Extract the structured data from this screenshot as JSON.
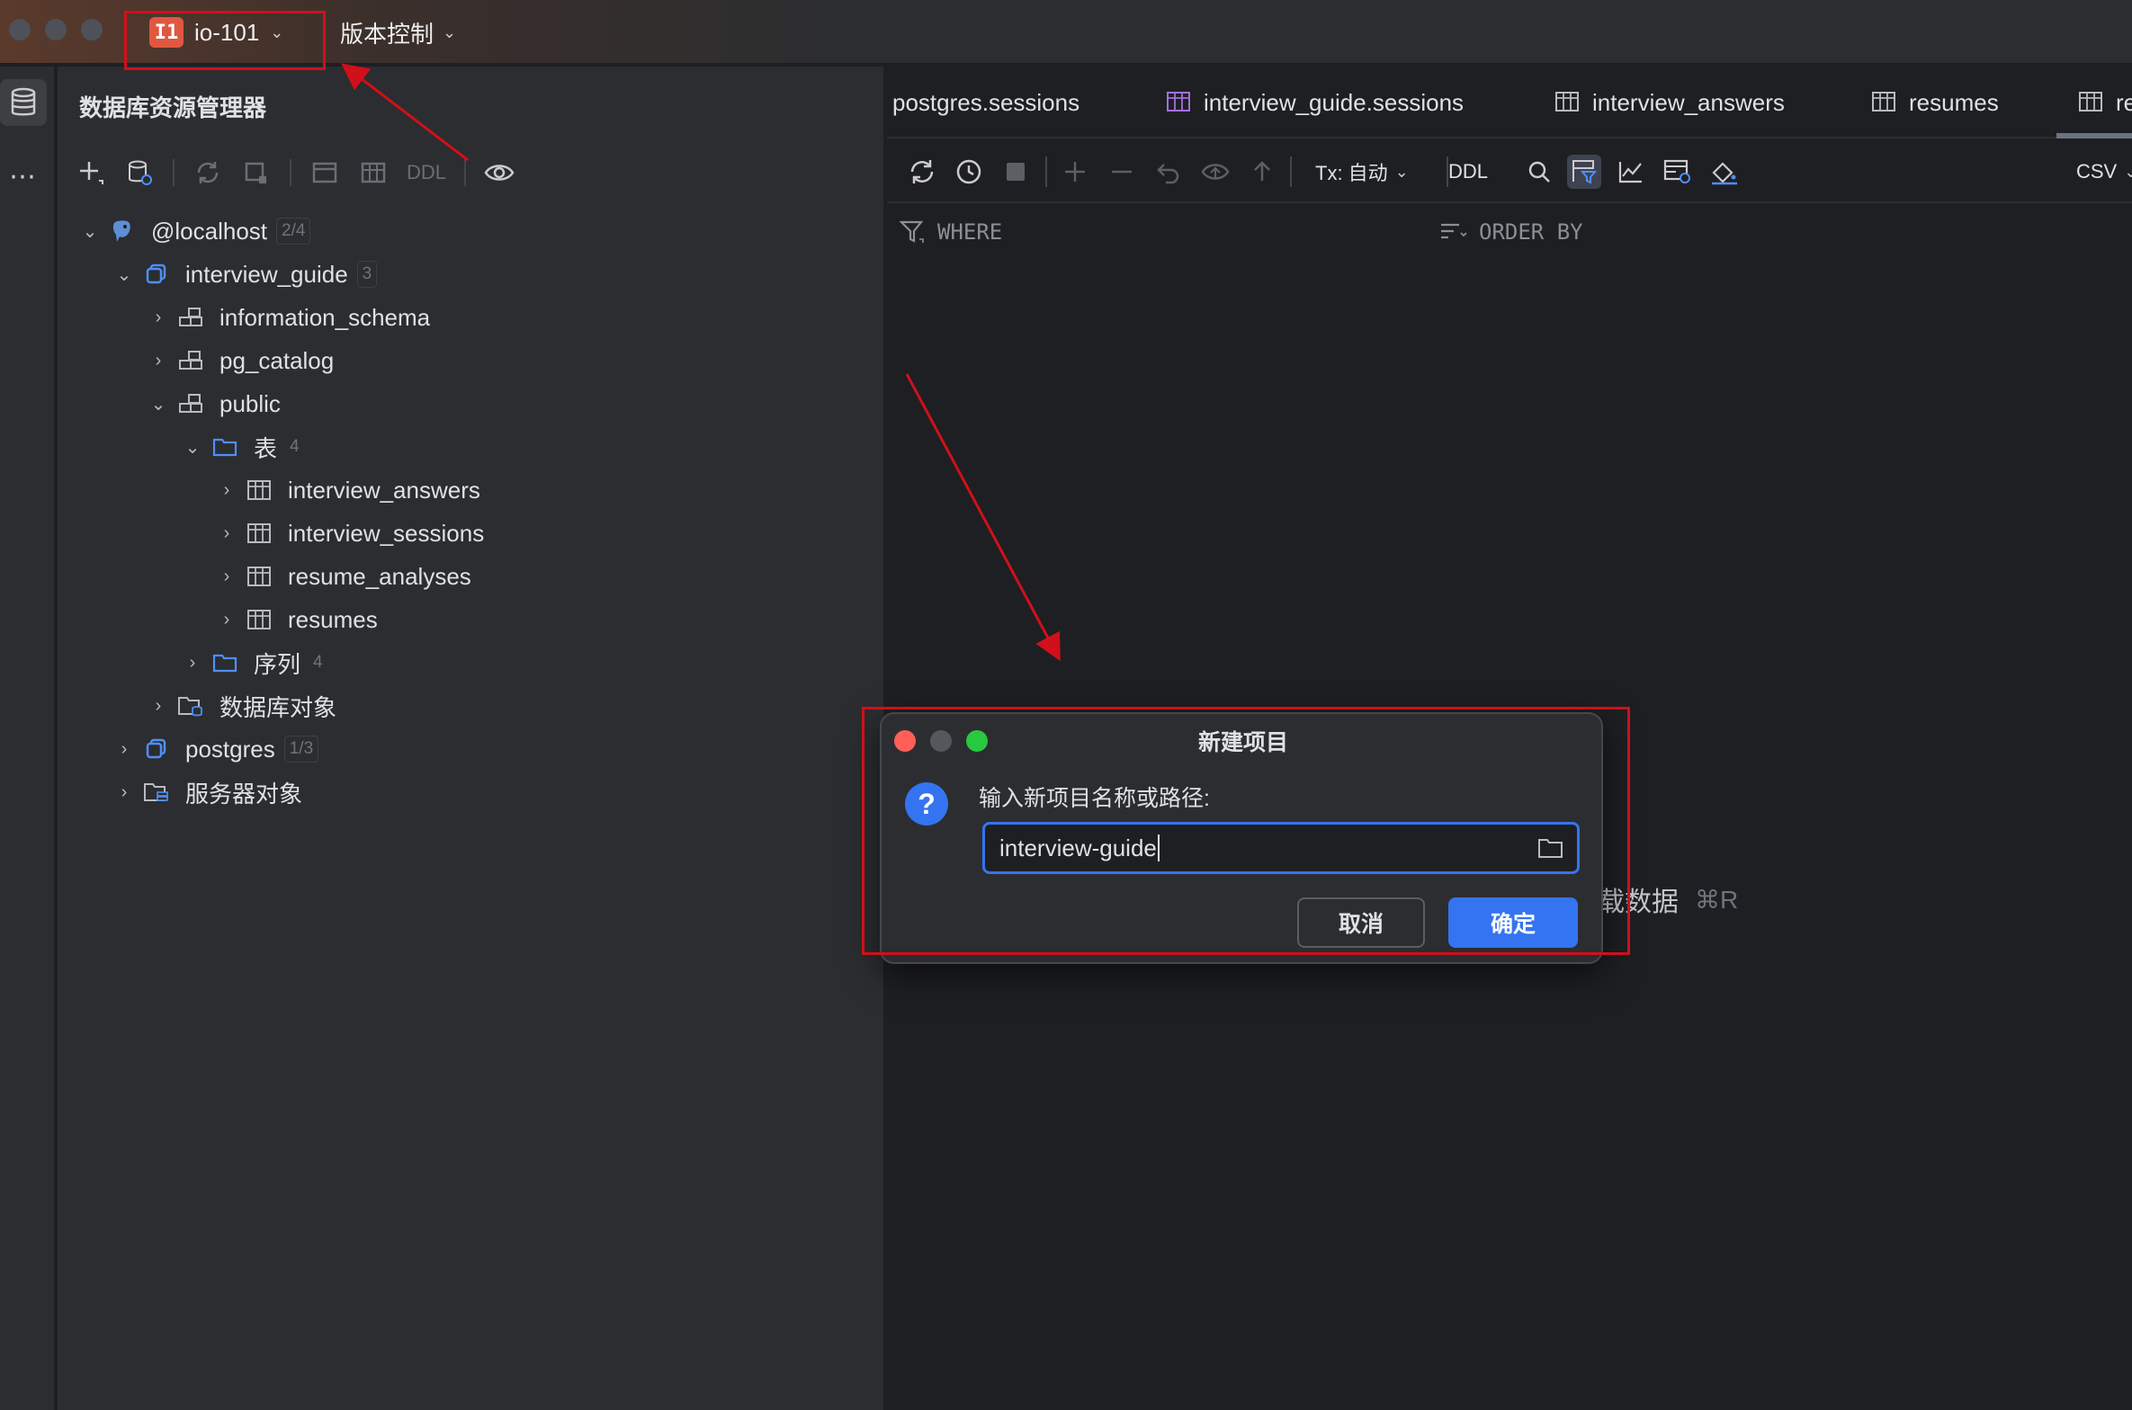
{
  "titlebar": {
    "project_badge": "I1",
    "project_name": "io-101",
    "vcs_label": "版本控制"
  },
  "explorer": {
    "title": "数据库资源管理器",
    "toolbar_ddl": "DDL"
  },
  "tree": {
    "localhost": {
      "label": "@localhost",
      "count": "2/4"
    },
    "interview_guide": {
      "label": "interview_guide",
      "count": "3"
    },
    "information_schema": {
      "label": "information_schema"
    },
    "pg_catalog": {
      "label": "pg_catalog"
    },
    "public": {
      "label": "public"
    },
    "tables": {
      "label": "表",
      "count": "4"
    },
    "interview_answers": {
      "label": "interview_answers"
    },
    "interview_sessions": {
      "label": "interview_sessions"
    },
    "resume_analyses": {
      "label": "resume_analyses"
    },
    "resumes": {
      "label": "resumes"
    },
    "sequences": {
      "label": "序列",
      "count": "4"
    },
    "db_objects": {
      "label": "数据库对象"
    },
    "postgres": {
      "label": "postgres",
      "count": "1/3"
    },
    "server_objects": {
      "label": "服务器对象"
    }
  },
  "tabs": [
    {
      "label": "postgres.sessions"
    },
    {
      "label": "interview_guide.sessions"
    },
    {
      "label": "interview_answers"
    },
    {
      "label": "resumes"
    },
    {
      "label": "re"
    }
  ],
  "editor_toolbar": {
    "tx_label": "Tx: 自动",
    "ddl_label": "DDL",
    "csv_label": "CSV"
  },
  "filter": {
    "where_label": "WHERE",
    "order_label": "ORDER BY"
  },
  "reload_hint": {
    "text": "载数据",
    "shortcut": "⌘R"
  },
  "dialog": {
    "title": "新建项目",
    "prompt": "输入新项目名称或路径:",
    "input_value": "interview-guide",
    "cancel_label": "取消",
    "ok_label": "确定"
  },
  "colors": {
    "accent": "#3574f0",
    "annotation": "#d0101a",
    "project_badge": "#e0573f",
    "folder": "#4f8ff7"
  }
}
